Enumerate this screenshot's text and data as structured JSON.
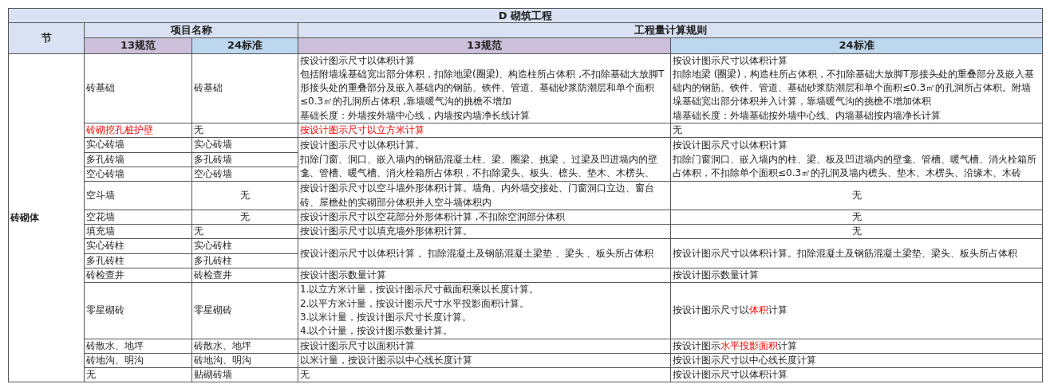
{
  "table": {
    "title": "D  砌筑工程",
    "header": {
      "section": "节",
      "names": "项目名称",
      "rules": "工程量计算规则",
      "names_13": "13规范",
      "names_24": "24标准",
      "rules_13": "13规范",
      "rules_24": "24标准"
    },
    "section_name": "砖砌体",
    "groups": [
      {
        "items": [
          {
            "name_13": {
              "text": "砖基础"
            },
            "name_24": {
              "text": "砖基础"
            }
          }
        ],
        "rule_13": {
          "lines": [
            "按设计图示尺寸以体积计算",
            "包括附墙垛基础宽出部分体积，扣除地梁(圈梁)、构造柱所占体积 ,不扣除基础大放脚T形接头处的重叠部分及嵌入基础内的钢筋、铁件、管道、基础砂浆防潮层和单个面积≤0.3㎡的孔洞所占体积 ,靠墙暖气沟的挑檐不增加",
            "基础长度：外墙按外墙中心线，内墙按内墙净长线计算"
          ]
        },
        "rule_24": {
          "lines": [
            "按设计图示尺寸以体积计算",
            "扣除地梁 (圈梁)，构造柱所占体积，不扣除基础大放脚T形接头处的重叠部分及嵌入基础内的钢筋、铁件、管道、基础砂浆防潮层和单个面积≤0.3㎡的孔洞所占体积。附墙垛基础宽出部分体积并入计算，靠墙暖气沟的挑檐不增加体积",
            "墙基础长度：外墙基础按外墙中心线、内墙基础按内墙净长计算"
          ]
        }
      },
      {
        "items": [
          {
            "name_13": {
              "text": "砖砌挖孔桩护壁",
              "highlight": true
            },
            "name_24": {
              "text": "无"
            }
          }
        ],
        "rule_13": {
          "lines": [
            "按设计图示尺寸以立方米计算"
          ],
          "highlight": true
        },
        "rule_24": {
          "lines": [
            "无"
          ]
        }
      },
      {
        "items": [
          {
            "name_13": {
              "text": "实心砖墙"
            },
            "name_24": {
              "text": "实心砖墙"
            }
          },
          {
            "name_13": {
              "text": "多孔砖墙"
            },
            "name_24": {
              "text": "多孔砖墙"
            }
          },
          {
            "name_13": {
              "text": "空心砖墙"
            },
            "name_24": {
              "text": "空心砖墙"
            }
          }
        ],
        "rule_13": {
          "lines": [
            "按设计图示尺寸以体积计算。",
            "扣除门窗、洞口、嵌入墙内的钢筋混凝土柱、梁、圈梁、挑梁 、过梁及凹进墙内的壁龛、管槽、暖气槽、消火栓箱所占体积，不扣除梁头、板头、檩头、垫木、木楞头、"
          ]
        },
        "rule_24": {
          "lines": [
            "按设计图示尺寸以体积计算",
            "扣除门窗洞口、嵌入墙内的柱、梁、板及凹进墙内的壁龛、管槽、暖气槽、消火栓箱所占体积，不扣除单个面积≤0.3㎡的孔洞及墙内檩头、垫木、木楞头、沿缘木、木砖"
          ]
        }
      },
      {
        "items": [
          {
            "name_13": {
              "text": "空斗墙"
            },
            "name_24": {
              "text": "无",
              "centered": true
            }
          }
        ],
        "rule_13": {
          "lines": [
            "按设计图示尺寸以空斗墙外形体积计算。墙角、内外墙交接处、门窗洞口立边、窗台砖、屋檐处的实砌部分体积并人空斗墙体积内"
          ]
        },
        "rule_24": {
          "lines": [
            "无"
          ],
          "centered": true
        }
      },
      {
        "items": [
          {
            "name_13": {
              "text": "空花墙"
            },
            "name_24": {
              "text": "无",
              "centered": true
            }
          }
        ],
        "rule_13": {
          "lines": [
            "按设计图示尺寸以空花部分外形体积计算 ,不扣除空洞部分体积"
          ]
        },
        "rule_24": {
          "lines": [
            "无"
          ],
          "centered": true
        }
      },
      {
        "items": [
          {
            "name_13": {
              "text": "填充墙"
            },
            "name_24": {
              "text": "无"
            }
          }
        ],
        "rule_13": {
          "lines": [
            "按设计图示尺寸以填充墙外形体积计算。"
          ]
        },
        "rule_24": {
          "lines": [
            "无"
          ],
          "centered": true
        }
      },
      {
        "items": [
          {
            "name_13": {
              "text": "实心砖柱"
            },
            "name_24": {
              "text": "实心砖柱"
            }
          },
          {
            "name_13": {
              "text": "多孔砖柱"
            },
            "name_24": {
              "text": "多孔砖柱"
            }
          }
        ],
        "rule_13": {
          "lines": [
            "按设计图示尺寸以体积计算 。扣除混凝土及钢筋混凝土梁垫 、梁头 、板头所占体积"
          ]
        },
        "rule_24": {
          "lines": [
            "按设计图示尺寸以体积计算。扣除混凝土及钢筋混凝土梁垫、梁头、板头所占体积"
          ]
        }
      },
      {
        "items": [
          {
            "name_13": {
              "text": "砖检查井"
            },
            "name_24": {
              "text": "砖检查井"
            }
          }
        ],
        "rule_13": {
          "lines": [
            "按设计图示数量计算"
          ]
        },
        "rule_24": {
          "lines": [
            "按设计图示数量计算"
          ]
        }
      },
      {
        "items": [
          {
            "name_13": {
              "text": "零星砌砖"
            },
            "name_24": {
              "text": "零星砌砖"
            }
          }
        ],
        "rule_13": {
          "lines": [
            "1.以立方米计量，按设计图示尺寸截面积乘以长度计算。",
            "2.以平方米计量，按设计图示尺寸水平投影面积计算。",
            "3.以米计量，按设计图示尺寸长度计算。",
            "4.以个计量，按设计图示数量计算。"
          ]
        },
        "rule_24": {
          "lines": [
            {
              "parts": [
                {
                  "text": "按设计图示尺寸以",
                  "highlight": false
                },
                {
                  "text": "体积",
                  "highlight": true
                },
                {
                  "text": "计算",
                  "highlight": false
                }
              ]
            }
          ]
        }
      },
      {
        "items": [
          {
            "name_13": {
              "text": "砖散水、地坪"
            },
            "name_24": {
              "text": "砖散水、地坪"
            }
          }
        ],
        "rule_13": {
          "lines": [
            "按设计图示尺寸以面积计算"
          ]
        },
        "rule_24": {
          "lines": [
            {
              "parts": [
                {
                  "text": "按设计图示",
                  "highlight": false
                },
                {
                  "text": "水平投影面积",
                  "highlight": true
                },
                {
                  "text": "计算",
                  "highlight": false
                }
              ]
            }
          ]
        }
      },
      {
        "items": [
          {
            "name_13": {
              "text": "砖地沟、明沟"
            },
            "name_24": {
              "text": "砖地沟、明沟"
            }
          }
        ],
        "rule_13": {
          "lines": [
            "以米计量，按设计图示以中心线长度计算"
          ]
        },
        "rule_24": {
          "lines": [
            "按设计图示尺寸以中心线长度计算"
          ]
        }
      },
      {
        "items": [
          {
            "name_13": {
              "text": "无"
            },
            "name_24": {
              "text": "贴砌砖墙"
            }
          }
        ],
        "rule_13": {
          "lines": [
            "无"
          ]
        },
        "rule_24": {
          "lines": [
            "按设计图示尺寸以体积计算"
          ]
        }
      }
    ]
  }
}
